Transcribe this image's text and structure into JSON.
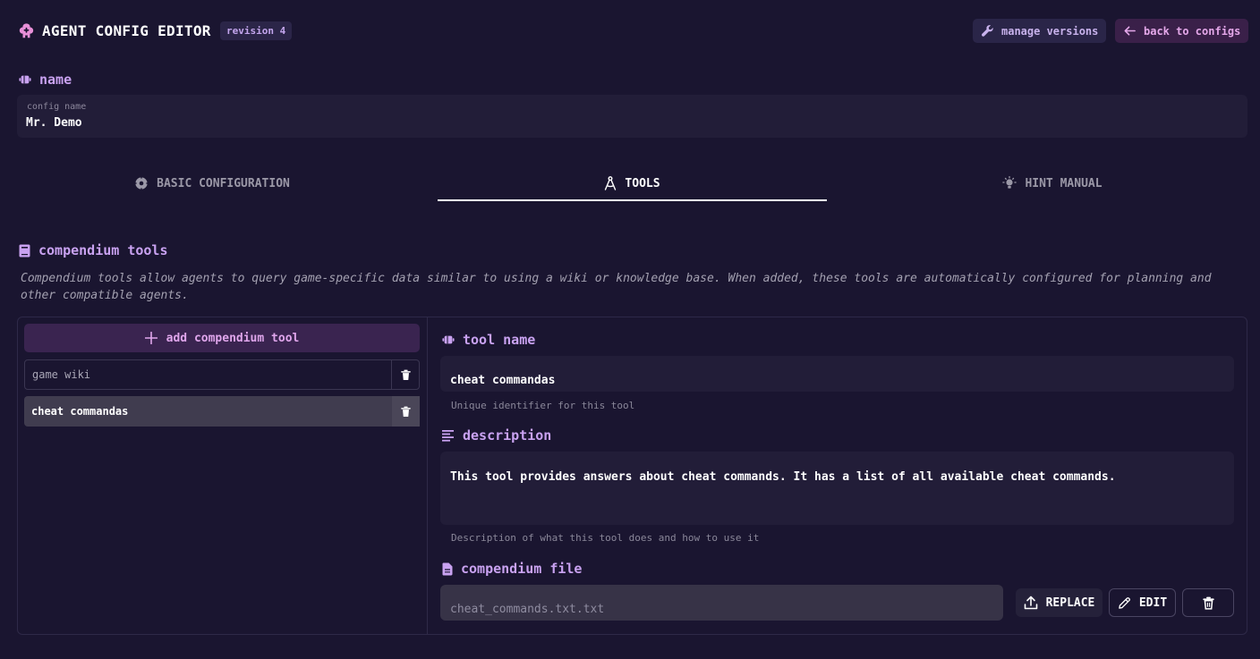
{
  "header": {
    "title": "AGENT CONFIG EDITOR",
    "revision": "revision 4",
    "manage_versions": "manage versions",
    "back_to_configs": "back to configs"
  },
  "name_section": {
    "label": "name",
    "field_caption": "config name",
    "field_value": "Mr. Demo"
  },
  "tabs": [
    {
      "label": "BASIC CONFIGURATION",
      "icon": "gear-icon",
      "active": false
    },
    {
      "label": "TOOLS",
      "icon": "compass-icon",
      "active": true
    },
    {
      "label": "HINT MANUAL",
      "icon": "bulb-icon",
      "active": false
    }
  ],
  "compendium": {
    "heading": "compendium tools",
    "description": "Compendium tools allow agents to query game-specific data similar to using a wiki or knowledge base. When added, these tools are automatically configured for planning and other compatible agents.",
    "add_button": "add compendium tool",
    "tools": [
      {
        "name": "game wiki",
        "selected": false
      },
      {
        "name": "cheat commandas",
        "selected": true
      }
    ]
  },
  "detail": {
    "tool_name_label": "tool name",
    "tool_name_value": "cheat commandas",
    "tool_name_hint": "Unique identifier for this tool",
    "description_label": "description",
    "description_value": "This tool provides answers about cheat commands. It has a list of all available cheat commands.",
    "description_hint": "Description of what this tool does and how to use it",
    "file_label": "compendium file",
    "file_value": "cheat_commands.txt.txt",
    "replace_button": "REPLACE",
    "edit_button": "EDIT"
  },
  "colors": {
    "background": "#1a1530",
    "accent_purple": "#c9a2f1",
    "accent_pink": "#e0a6ec",
    "field_bg": "#221d38"
  }
}
